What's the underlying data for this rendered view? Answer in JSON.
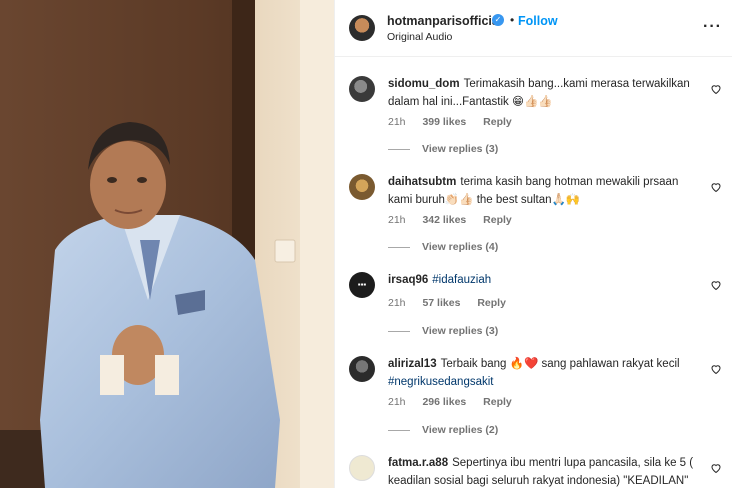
{
  "post": {
    "username": "hotmanparisofficial",
    "verified": true,
    "separator": "•",
    "follow_label": "Follow",
    "audio_label": "Original Audio",
    "more_icon": "more-options-icon"
  },
  "comments": [
    {
      "username": "sidomu_dom",
      "text": "Terimakasih bang...kami merasa terwakilkan dalam hal ini...Fantastik 😁👍🏻👍🏻",
      "time": "21h",
      "likes": "399 likes",
      "reply_label": "Reply",
      "view_replies": "View replies (3)",
      "avatar_color": "#4a4a4a"
    },
    {
      "username": "daihatsubtm",
      "text": "terima kasih bang hotman mewakili prsaan kami buruh👏🏻👍🏻 the best sultan🙏🏻🙌",
      "time": "21h",
      "likes": "342 likes",
      "reply_label": "Reply",
      "view_replies": "View replies (4)",
      "avatar_color": "#8a6a3a"
    },
    {
      "username": "irsaq96",
      "text": "",
      "tag": "#idafauziah",
      "time": "21h",
      "likes": "57 likes",
      "reply_label": "Reply",
      "view_replies": "View replies (3)",
      "avatar_color": "#1a1a1a"
    },
    {
      "username": "alirizal13",
      "text": "Terbaik bang 🔥❤️ sang pahlawan rakyat kecil",
      "tag": "#negrikusedangsakit",
      "time": "21h",
      "likes": "296 likes",
      "reply_label": "Reply",
      "view_replies": "View replies (2)",
      "avatar_color": "#3a3a3a"
    },
    {
      "username": "fatma.r.a88",
      "text": "Sepertinya ibu mentri lupa pancasila, sila ke 5 ( keadilan sosial bagi seluruh rakyat indonesia) \"KEADILAN\"",
      "avatar_color": "#e8e4d0"
    }
  ],
  "colors": {
    "link_blue": "#0095f6",
    "hashtag": "#00376b",
    "meta_gray": "#737373"
  }
}
